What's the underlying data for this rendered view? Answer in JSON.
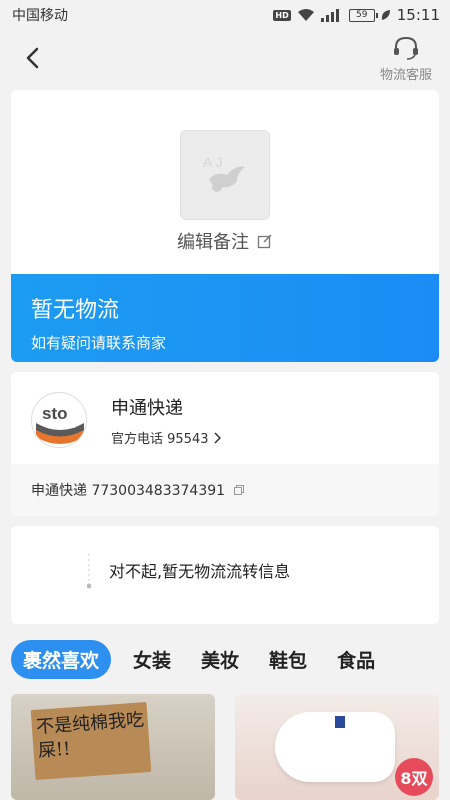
{
  "status_bar": {
    "carrier": "中国移动",
    "hd": "HD",
    "battery": "59",
    "time": "15:11"
  },
  "nav": {
    "back_icon": "chevron-left-icon",
    "service_icon": "headset-icon",
    "service_label": "物流客服"
  },
  "note": {
    "image_icon": "bird-placeholder-icon",
    "label": "编辑备注",
    "edit_icon": "edit-icon"
  },
  "banner": {
    "title": "暂无物流",
    "subtitle": "如有疑问请联系商家"
  },
  "courier": {
    "logo_text": "sto",
    "logo_sub": "express",
    "name": "申通快递",
    "phone_label": "官方电话 95543",
    "tracking": "申通快递 773003483374391",
    "copy_icon": "copy-icon"
  },
  "logistics": {
    "empty_message": "对不起,暂无物流流转信息"
  },
  "tabs": [
    "裹然喜欢",
    "女装",
    "美妆",
    "鞋包",
    "食品"
  ],
  "products": {
    "left_handwriting": "不是纯棉我吃屎!!",
    "right_badge": "8双"
  },
  "colors": {
    "accent": "#1b8cf5",
    "tab_active": "#2d8ff0",
    "badge": "#e64b5c"
  }
}
